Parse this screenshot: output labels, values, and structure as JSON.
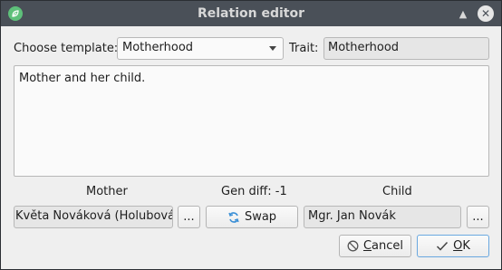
{
  "window": {
    "title": "Relation editor",
    "icons": {
      "app": "app-leaf-icon",
      "shade": "shade-up-icon",
      "close": "close-icon"
    }
  },
  "template": {
    "label": "Choose template:",
    "value": "Motherhood"
  },
  "trait": {
    "label": "Trait:",
    "value": "Motherhood"
  },
  "description": "Mother and her child.",
  "relation": {
    "left_role": "Mother",
    "gen_diff": "Gen diff: -1",
    "right_role": "Child",
    "left_person": "Květa Nováková (Holubová)",
    "right_person": "Mgr. Jan Novák",
    "browse_label": "...",
    "swap_label": "Swap",
    "swap_icon": "swap-arrows-icon"
  },
  "buttons": {
    "cancel_prefix": "",
    "cancel_underlined": "C",
    "cancel_rest": "ancel",
    "cancel_icon": "cancel-circle-icon",
    "ok_underlined": "O",
    "ok_rest": "K",
    "ok_icon": "checkmark-icon"
  },
  "colors": {
    "accent": "#6aa8e0",
    "titlebar": "#4a5058",
    "swap_icon": "#3a8fd6"
  }
}
